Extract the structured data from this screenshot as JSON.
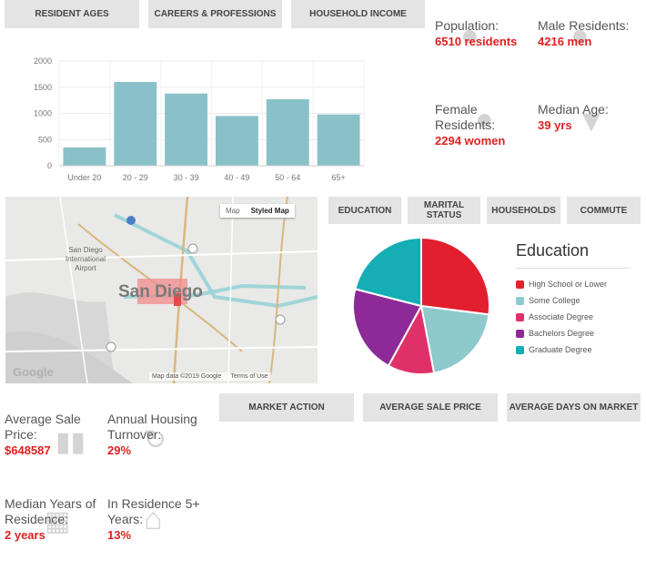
{
  "top_tabs": [
    "RESIDENT AGES",
    "CAREERS & PROFESSIONS",
    "HOUSEHOLD INCOME"
  ],
  "mid_tabs": [
    "EDUCATION",
    "MARITAL STATUS",
    "HOUSEHOLDS",
    "COMMUTE"
  ],
  "market_tabs": [
    "MARKET ACTION",
    "AVERAGE SALE PRICE",
    "AVERAGE DAYS ON MARKET"
  ],
  "stats": {
    "population": {
      "label": "Population:",
      "value": "6510 residents"
    },
    "male": {
      "label": "Male Residents:",
      "value": "4216 men"
    },
    "female": {
      "label": "Female Residents:",
      "value": "2294 women"
    },
    "median_age": {
      "label": "Median Age:",
      "value": "39 yrs"
    },
    "avg_sale": {
      "label": "Average Sale Price:",
      "value": "$648587"
    },
    "turnover": {
      "label": "Annual Housing Turnover:",
      "value": "29%"
    },
    "median_years": {
      "label": "Median Years of Residence:",
      "value": "2 years"
    },
    "residence5": {
      "label": "In Residence 5+ Years:",
      "value": "13%"
    }
  },
  "map": {
    "toggle_map": "Map",
    "toggle_styled": "Styled Map",
    "city_label": "San Diego",
    "airport_label": "San Diego International Airport",
    "footer_data": "Map data ©2019 Google",
    "footer_terms": "Terms of Use",
    "google": "Google"
  },
  "chart_data": [
    {
      "type": "bar",
      "categories": [
        "Under 20",
        "20 - 29",
        "30 - 39",
        "40 - 49",
        "50 - 64",
        "65+"
      ],
      "values": [
        350,
        1600,
        1380,
        950,
        1270,
        980
      ],
      "ylim": [
        0,
        2000
      ],
      "yticks": [
        "0",
        "500",
        "1000",
        "1500",
        "2000"
      ],
      "color": "#8ac1c9",
      "grid": true
    },
    {
      "type": "pie",
      "title": "Education",
      "series": [
        {
          "name": "High School or Lower",
          "value": 27,
          "color": "#e21f2e"
        },
        {
          "name": "Some College",
          "value": 20,
          "color": "#8ec9cc"
        },
        {
          "name": "Associate Degree",
          "value": 11,
          "color": "#e0306a"
        },
        {
          "name": "Bachelors Degree",
          "value": 21,
          "color": "#8d2a98"
        },
        {
          "name": "Graduate Degree",
          "value": 21,
          "color": "#14aeb4"
        }
      ],
      "legend_position": "right"
    }
  ]
}
